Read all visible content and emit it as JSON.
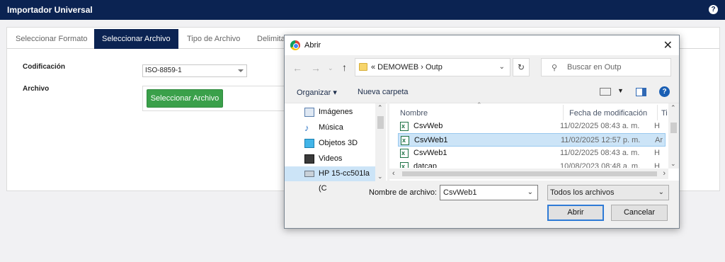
{
  "app": {
    "title": "Importador Universal",
    "help_glyph": "?"
  },
  "tabs": [
    {
      "label": "Seleccionar Formato"
    },
    {
      "label": "Seleccionar Archivo"
    },
    {
      "label": "Tipo de Archivo"
    },
    {
      "label": "Delimita"
    }
  ],
  "form": {
    "encoding_label": "Codificación",
    "encoding_value": "ISO-8859-1",
    "file_label": "Archivo",
    "select_file_button": "Seleccionar Archivo"
  },
  "dialog": {
    "title": "Abrir",
    "close_glyph": "✕",
    "path": "«  DEMOWEB  ›  Outp",
    "search_placeholder": "Buscar en Outp",
    "organize_label": "Organizar ▾",
    "new_folder_label": "Nueva carpeta",
    "help_glyph": "?",
    "nav_items": [
      {
        "label": "Imágenes",
        "icon": "images-icon"
      },
      {
        "label": "Música",
        "icon": "music-icon"
      },
      {
        "label": "Objetos 3D",
        "icon": "objects-3d-icon"
      },
      {
        "label": "Videos",
        "icon": "videos-icon"
      },
      {
        "label": "HP 15-cc501la (C",
        "icon": "drive-icon"
      }
    ],
    "columns": {
      "name": "Nombre",
      "date": "Fecha de modificación",
      "type": "Ti"
    },
    "files": [
      {
        "name": "CsvWeb",
        "date": "11/02/2025 08:43 a. m.",
        "type": "H"
      },
      {
        "name": "CsvWeb1",
        "date": "11/02/2025 12:57 p. m.",
        "type": "Ar"
      },
      {
        "name": "CsvWeb1",
        "date": "11/02/2025 08:43 a. m.",
        "type": "H"
      },
      {
        "name": "datcap",
        "date": "10/08/2023 08:48 a. m.",
        "type": "H"
      }
    ],
    "filename_label": "Nombre de archivo:",
    "filename_value": "CsvWeb1",
    "filetype_value": "Todos los archivos",
    "open_button": "Abrir",
    "cancel_button": "Cancelar"
  }
}
